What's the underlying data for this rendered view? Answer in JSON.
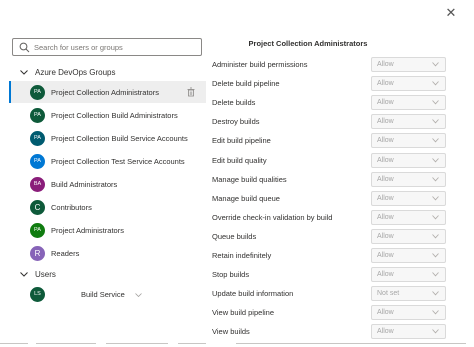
{
  "dialog": {
    "close_glyph": "✕"
  },
  "search": {
    "placeholder": "Search for users or groups"
  },
  "groups_section": {
    "label": "Azure DevOps Groups",
    "items": [
      {
        "initials": "PA",
        "label": "Project Collection Administrators",
        "color": "#0e5a3a",
        "selected": true
      },
      {
        "initials": "PA",
        "label": "Project Collection Build Administrators",
        "color": "#0e5a3a",
        "selected": false
      },
      {
        "initials": "PA",
        "label": "Project Collection Build Service Accounts",
        "color": "#005b70",
        "selected": false
      },
      {
        "initials": "PA",
        "label": "Project Collection Test Service Accounts",
        "color": "#0078d4",
        "selected": false
      },
      {
        "initials": "BA",
        "label": "Build Administrators",
        "color": "#8a1d7a",
        "selected": false
      },
      {
        "initials": "C",
        "label": "Contributors",
        "color": "#0e5a3a",
        "selected": false
      },
      {
        "initials": "PA",
        "label": "Project Administrators",
        "color": "#107c10",
        "selected": false
      },
      {
        "initials": "R",
        "label": "Readers",
        "color": "#8764b8",
        "selected": false
      }
    ]
  },
  "users_section": {
    "label": "Users",
    "items": [
      {
        "initials": "LS",
        "label": "Build Service",
        "color": "#0e5a3a"
      }
    ]
  },
  "permissions_panel": {
    "title": "Project Collection Administrators",
    "rows": [
      {
        "name": "Administer build permissions",
        "value": "Allow"
      },
      {
        "name": "Delete build pipeline",
        "value": "Allow"
      },
      {
        "name": "Delete builds",
        "value": "Allow"
      },
      {
        "name": "Destroy builds",
        "value": "Allow"
      },
      {
        "name": "Edit build pipeline",
        "value": "Allow"
      },
      {
        "name": "Edit build quality",
        "value": "Allow"
      },
      {
        "name": "Manage build qualities",
        "value": "Allow"
      },
      {
        "name": "Manage build queue",
        "value": "Allow"
      },
      {
        "name": "Override check-in validation by build",
        "value": "Allow"
      },
      {
        "name": "Queue builds",
        "value": "Allow"
      },
      {
        "name": "Retain indefinitely",
        "value": "Allow"
      },
      {
        "name": "Stop builds",
        "value": "Allow"
      },
      {
        "name": "Update build information",
        "value": "Not set"
      },
      {
        "name": "View build pipeline",
        "value": "Allow"
      },
      {
        "name": "View builds",
        "value": "Allow"
      }
    ]
  }
}
